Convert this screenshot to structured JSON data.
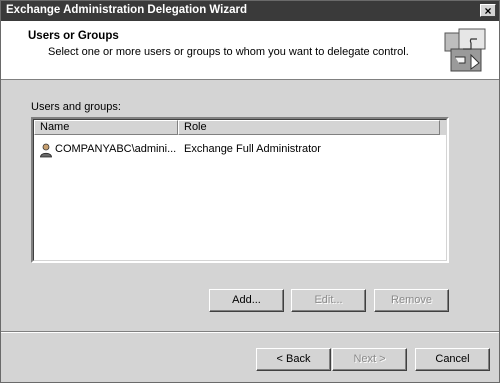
{
  "window": {
    "title": "Exchange Administration Delegation Wizard",
    "close_glyph": "×"
  },
  "header": {
    "title": "Users or Groups",
    "subtitle": "Select one or more users or groups to whom you want to delegate control.",
    "icon": "wizard-puzzle-icon"
  },
  "users_groups": {
    "label": "Users and groups:",
    "columns": [
      "Name",
      "Role"
    ],
    "rows": [
      {
        "name": "COMPANYABC\\admini...",
        "role": "Exchange Full Administrator",
        "icon": "user-icon"
      }
    ]
  },
  "buttons": {
    "add": "Add...",
    "edit": "Edit...",
    "remove": "Remove",
    "back": "< Back",
    "next": "Next >",
    "cancel": "Cancel"
  }
}
